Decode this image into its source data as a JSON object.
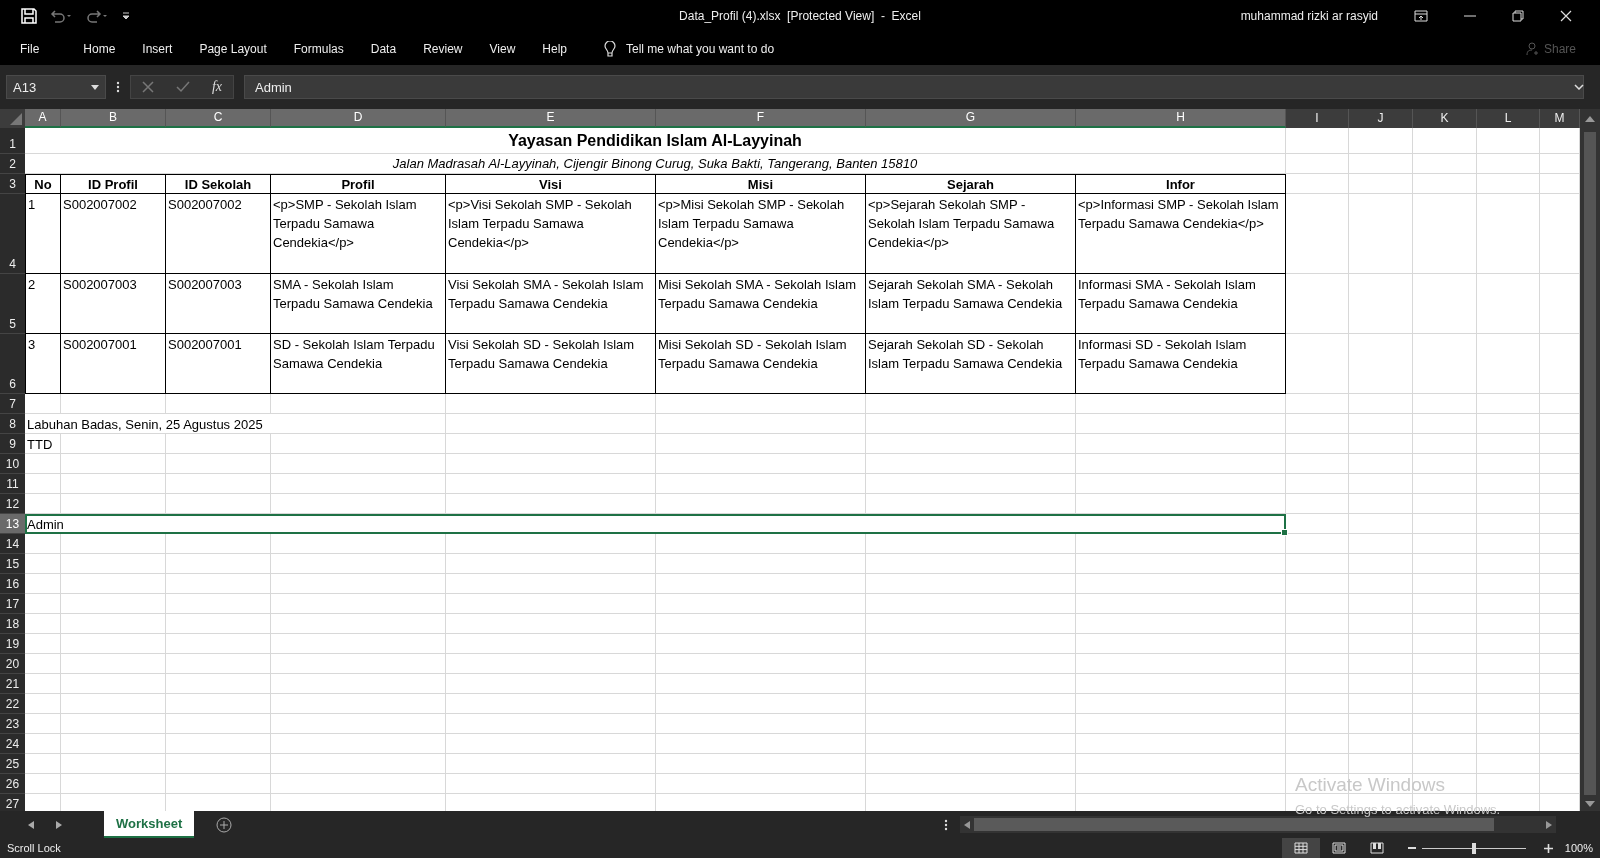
{
  "title_bar": {
    "title": "Data_Profil (4).xlsx  [Protected View]  -  Excel",
    "user": "muhammad rizki ar rasyid"
  },
  "ribbon": {
    "tabs": [
      {
        "label": "File"
      },
      {
        "label": "Home"
      },
      {
        "label": "Insert"
      },
      {
        "label": "Page Layout"
      },
      {
        "label": "Formulas"
      },
      {
        "label": "Data"
      },
      {
        "label": "Review"
      },
      {
        "label": "View"
      },
      {
        "label": "Help"
      }
    ],
    "tell_me": "Tell me what you want to do",
    "share": "Share"
  },
  "formula_bar": {
    "name_box": "A13",
    "function_label": "fx",
    "value": "Admin"
  },
  "sheet": {
    "columns": [
      {
        "label": "A",
        "selected": true
      },
      {
        "label": "B",
        "selected": true
      },
      {
        "label": "C",
        "selected": true
      },
      {
        "label": "D",
        "selected": true
      },
      {
        "label": "E",
        "selected": true
      },
      {
        "label": "F",
        "selected": true
      },
      {
        "label": "G",
        "selected": true
      },
      {
        "label": "H",
        "selected": true
      },
      {
        "label": "I",
        "selected": false
      },
      {
        "label": "J",
        "selected": false
      },
      {
        "label": "K",
        "selected": false
      },
      {
        "label": "L",
        "selected": false
      },
      {
        "label": "M",
        "selected": false
      }
    ],
    "rows": [
      {
        "label": "1",
        "selected": false
      },
      {
        "label": "2",
        "selected": false
      },
      {
        "label": "3",
        "selected": false
      },
      {
        "label": "4",
        "selected": false
      },
      {
        "label": "5",
        "selected": false
      },
      {
        "label": "6",
        "selected": false
      },
      {
        "label": "7",
        "selected": false
      },
      {
        "label": "8",
        "selected": false
      },
      {
        "label": "9",
        "selected": false
      },
      {
        "label": "10",
        "selected": false
      },
      {
        "label": "11",
        "selected": false
      },
      {
        "label": "12",
        "selected": false
      },
      {
        "label": "13",
        "selected": true
      },
      {
        "label": "14",
        "selected": false
      },
      {
        "label": "15",
        "selected": false
      },
      {
        "label": "16",
        "selected": false
      },
      {
        "label": "17",
        "selected": false
      },
      {
        "label": "18",
        "selected": false
      },
      {
        "label": "19",
        "selected": false
      },
      {
        "label": "20",
        "selected": false
      },
      {
        "label": "21",
        "selected": false
      },
      {
        "label": "22",
        "selected": false
      },
      {
        "label": "23",
        "selected": false
      },
      {
        "label": "24",
        "selected": false
      },
      {
        "label": "25",
        "selected": false
      },
      {
        "label": "26",
        "selected": false
      },
      {
        "label": "27",
        "selected": false
      }
    ],
    "title": "Yayasan Pendidikan Islam Al-Layyinah",
    "subtitle": "Jalan Madrasah Al-Layyinah, Cijengir Binong Curug, Suka Bakti, Tangerang, Banten 15810",
    "table": {
      "columns": [
        "No",
        "ID Profil",
        "ID Sekolah",
        "Profil",
        "Visi",
        "Misi",
        "Sejarah",
        "Infor"
      ],
      "rows": [
        [
          "1",
          "S002007002",
          "S002007002",
          "<p>SMP - Sekolah Islam Terpadu Samawa Cendekia</p>",
          "<p>Visi Sekolah SMP - Sekolah Islam Terpadu Samawa Cendekia</p>",
          "<p>Misi Sekolah SMP - Sekolah Islam Terpadu Samawa Cendekia</p>",
          "<p>Sejarah Sekolah SMP - Sekolah Islam Terpadu Samawa Cendekia</p>",
          "<p>Informasi SMP - Sekolah Islam Terpadu Samawa Cendekia</p>"
        ],
        [
          "2",
          "S002007003",
          "S002007003",
          "SMA - Sekolah Islam Terpadu Samawa Cendekia",
          "Visi Sekolah SMA - Sekolah Islam Terpadu Samawa Cendekia",
          "Misi Sekolah SMA - Sekolah Islam Terpadu Samawa Cendekia",
          "Sejarah Sekolah SMA - Sekolah Islam Terpadu Samawa Cendekia",
          "Informasi SMA - Sekolah Islam Terpadu Samawa Cendekia"
        ],
        [
          "3",
          "S002007001",
          "S002007001",
          "SD - Sekolah Islam Terpadu Samawa Cendekia",
          "Visi Sekolah SD - Sekolah Islam Terpadu Samawa Cendekia",
          "Misi Sekolah SD - Sekolah Islam Terpadu Samawa Cendekia",
          "Sejarah Sekolah SD - Sekolah Islam Terpadu Samawa Cendekia",
          "Informasi SD - Sekolah Islam Terpadu Samawa Cendekia"
        ]
      ]
    },
    "place_date": "Labuhan Badas, Senin, 25 Agustus 2025",
    "signature_label": "TTD",
    "signer": "Admin"
  },
  "sheet_tabs": [
    {
      "label": "Worksheet",
      "selected": true
    }
  ],
  "status_bar": {
    "mode": "Scroll Lock",
    "views": [
      {
        "kind": "normal",
        "selected": true
      },
      {
        "kind": "page_layout",
        "selected": false
      },
      {
        "kind": "page_break",
        "selected": false
      }
    ],
    "zoom": {
      "level": 0.5,
      "reading": "100%"
    }
  },
  "activation_notice": {
    "title": "Activate Windows",
    "text": "Go to Settings to activate Windows."
  }
}
